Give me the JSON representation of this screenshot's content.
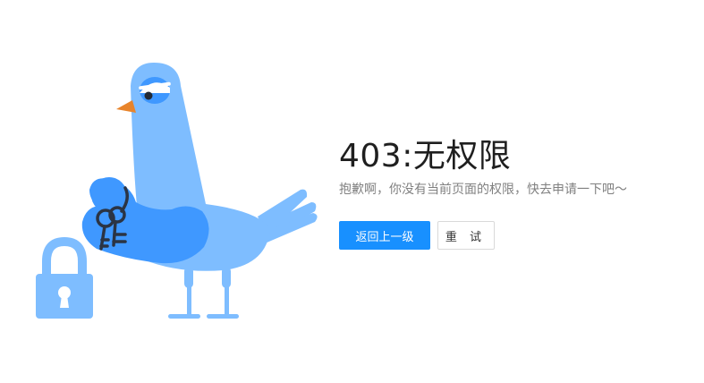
{
  "error": {
    "title": "403:无权限",
    "description": "抱歉啊，你没有当前页面的权限，快去申请一下吧～"
  },
  "actions": {
    "back_label": "返回上一级",
    "retry_label": "重 试"
  },
  "colors": {
    "primary": "#1890ff",
    "illustration_light": "#7ebdff",
    "illustration_dark": "#3f98ff",
    "beak": "#e8842b",
    "key": "#2b3444"
  }
}
